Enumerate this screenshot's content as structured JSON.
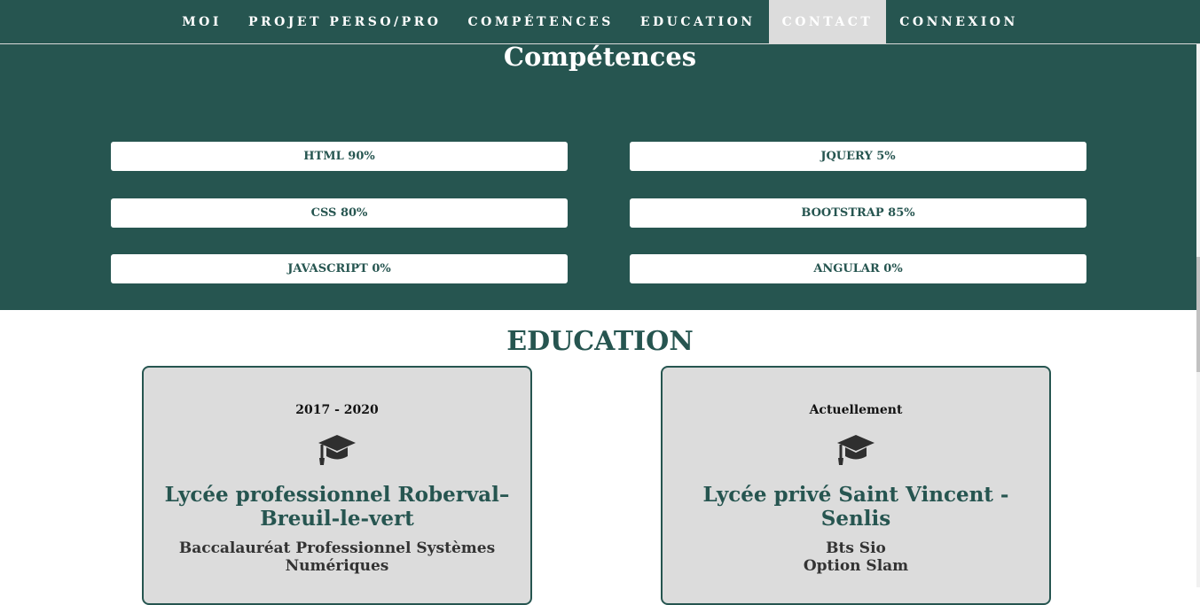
{
  "nav": {
    "items": [
      {
        "label": "MOI"
      },
      {
        "label": "PROJET PERSO/PRO"
      },
      {
        "label": "COMPÉTENCES"
      },
      {
        "label": "EDUCATION"
      },
      {
        "label": "CONTACT",
        "active": true
      },
      {
        "label": "CONNEXION"
      }
    ]
  },
  "skills": {
    "title": "Compétences",
    "items": [
      {
        "label": "HTML 90%",
        "level": 90
      },
      {
        "label": "JQUERY 5%",
        "level": 5
      },
      {
        "label": "CSS 80%",
        "level": 80
      },
      {
        "label": "BOOTSTRAP 85%",
        "level": 85
      },
      {
        "label": "JAVASCRIPT 0%",
        "level": 0
      },
      {
        "label": "ANGULAR 0%",
        "level": 0
      }
    ]
  },
  "education": {
    "title": "EDUCATION",
    "cards": [
      {
        "date": "2017 - 2020",
        "icon": "graduation-cap-icon",
        "school": "Lycée professionnel Roberval–Breuil-le-vert",
        "degree_lines": [
          "Baccalauréat Professionnel Systèmes",
          "Numériques"
        ]
      },
      {
        "date": "Actuellement",
        "icon": "graduation-cap-icon",
        "school": "Lycée privé Saint Vincent - Senlis",
        "degree_lines": [
          "Bts Sio",
          "Option Slam"
        ]
      }
    ]
  },
  "colors": {
    "primary": "#265550",
    "card_bg": "#dcdcdc",
    "white": "#ffffff"
  }
}
